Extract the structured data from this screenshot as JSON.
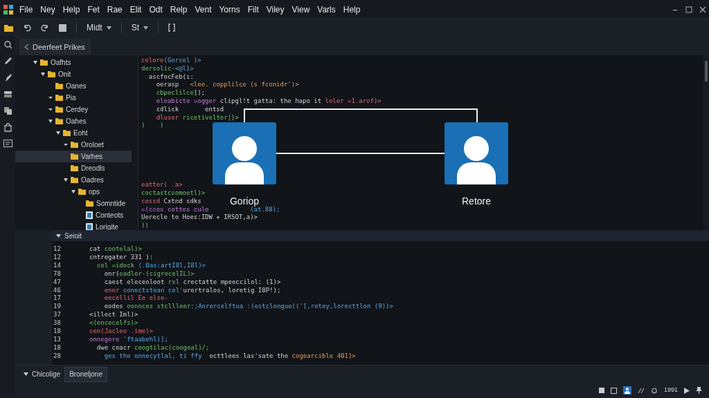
{
  "menu": [
    "File",
    "Ney",
    "Help",
    "Fet",
    "Rae",
    "Elit",
    "Odt",
    "Relp",
    "Vent",
    "Yorns",
    "Filt",
    "Viley",
    "View",
    "Varls",
    "Help"
  ],
  "toolbar": {
    "dropdowns": [
      {
        "label": "Midt"
      },
      {
        "label": "St"
      }
    ]
  },
  "editor_tab": {
    "label": "Deerfeet Prikes"
  },
  "tree": [
    {
      "label": "Oafhts",
      "kind": "folder",
      "expanded": true,
      "selected": false,
      "children": [
        {
          "label": "Onit",
          "kind": "folder",
          "expanded": true,
          "selected": false,
          "children": [
            {
              "label": "Oanes",
              "kind": "folder",
              "selected": false
            },
            {
              "label": "Pia",
              "kind": "folder",
              "expanded": false,
              "selected": false
            },
            {
              "label": "Cerdey",
              "kind": "folder",
              "expanded": false,
              "selected": false
            },
            {
              "label": "Oahes",
              "kind": "folder",
              "expanded": true,
              "selected": false,
              "children": [
                {
                  "label": "Eoht",
                  "kind": "folder",
                  "expanded": true,
                  "selected": false,
                  "children": [
                    {
                      "label": "Oroloet",
                      "kind": "folder",
                      "expanded": false,
                      "selected": false
                    },
                    {
                      "label": "Varhes",
                      "kind": "folder",
                      "selected": true
                    },
                    {
                      "label": "Dreodls",
                      "kind": "folder",
                      "selected": false
                    },
                    {
                      "label": "Oadres",
                      "kind": "folder",
                      "expanded": true,
                      "selected": false,
                      "children": [
                        {
                          "label": "ops",
                          "kind": "folder",
                          "expanded": true,
                          "selected": false,
                          "children": [
                            {
                              "label": "Somntide",
                              "kind": "folder",
                              "selected": false
                            },
                            {
                              "label": "Conteots",
                              "kind": "file",
                              "selected": false
                            },
                            {
                              "label": "Lorigite",
                              "kind": "file",
                              "selected": false
                            }
                          ]
                        }
                      ]
                    }
                  ]
                }
              ]
            }
          ]
        }
      ]
    }
  ],
  "top_code": [
    [
      [
        {
          "text": "celore(",
          "kind": "tag"
        },
        {
          "text": "Gorcel )>",
          "kind": "attr"
        }
      ],
      [
        {
          "text": "dersolic-<",
          "kind": "name"
        },
        {
          "text": "@l}>",
          "kind": "attr"
        }
      ],
      [
        {
          "text": "  ascfocFeb(ı:",
          "kind": "plain"
        }
      ],
      [
        {
          "text": "    oerasp   ",
          "kind": "plain"
        },
        {
          "text": "<lee. copplilce (s fconidr')>",
          "kind": "string"
        }
      ],
      [
        {
          "text": "    cbpeclilce",
          "kind": "name"
        },
        {
          "text": "]);",
          "kind": "plain"
        }
      ],
      [
        {
          "text": "    eleabicte =ogger ",
          "kind": "keyword"
        },
        {
          "text": "clipgl!t gatta: the hapo it ",
          "kind": "plain"
        },
        {
          "text": "loler =1.arof)>",
          "kind": "tag"
        }
      ],
      [
        {
          "text": "    cdlick       entsd",
          "kind": "plain"
        }
      ],
      [
        {
          "text": "    dluser ",
          "kind": "tag"
        },
        {
          "text": "ricetivelter|}>",
          "kind": "name"
        }
      ],
      [
        {
          "text": ")    )",
          "kind": "name"
        }
      ]
    ],
    [
      [
        {
          "text": "eatter( .a>",
          "kind": "tag"
        }
      ],
      [
        {
          "text": "coctastcsomoetl)>",
          "kind": "name"
        }
      ],
      [
        {
          "text": "cossd ",
          "kind": "tag"
        },
        {
          "text": "Cxtnd sdks",
          "kind": "plain"
        }
      ],
      [
        {
          "text": "=(cces cettes cule           ",
          "kind": "keyword"
        },
        {
          "text": "(at.88);",
          "kind": "attr"
        }
      ],
      [
        {
          "text": "Uerecle to Hoes:IDW + IRSOT,a)>",
          "kind": "plain"
        }
      ],
      [
        {
          "text": "))",
          "kind": "name"
        }
      ]
    ]
  ],
  "diagram": {
    "nodes": [
      {
        "label": "Goriop"
      },
      {
        "label": "Retore"
      }
    ]
  },
  "panel": {
    "title": "Seioit"
  },
  "bottom_code": [
    {
      "number": "12",
      "segments": [
        {
          "text": "cat ",
          "kind": "plain"
        },
        {
          "text": "cootelal)>",
          "kind": "name"
        }
      ]
    },
    {
      "number": "12",
      "segments": [
        {
          "text": "cntregater 331 ):",
          "kind": "plain"
        }
      ]
    },
    {
      "number": "14",
      "segments": [
        {
          "text": "  cel =ideck ",
          "kind": "name"
        },
        {
          "text": "(.0as:artI8l,I8l)>",
          "kind": "attr"
        }
      ]
    },
    {
      "number": "78",
      "segments": [
        {
          "text": "    onr(",
          "kind": "plain"
        },
        {
          "text": "eadler-(cigrecelIL)>",
          "kind": "name"
        }
      ]
    },
    {
      "number": "47",
      "segments": [
        {
          "text": "    caest eleceoleot ",
          "kind": "plain"
        },
        {
          "text": "rxl ",
          "kind": "name"
        },
        {
          "text": "crectatte mpeeccilol: (1)>",
          "kind": "plain"
        }
      ]
    },
    {
      "number": "46",
      "segments": [
        {
          "text": "    ener ",
          "kind": "tag"
        },
        {
          "text": "conectstean cel'",
          "kind": "attr"
        },
        {
          "text": "urertralos, loretig I8P!);",
          "kind": "plain"
        }
      ]
    },
    {
      "number": "17",
      "segments": [
        {
          "text": "    eecellil Ee else-",
          "kind": "tag"
        }
      ]
    },
    {
      "number": "19",
      "segments": [
        {
          "text": "    eodes ",
          "kind": "plain"
        },
        {
          "text": "oonoces stcllleer:",
          "kind": "name"
        },
        {
          "text": ";Anrercelftua :(estclongue(('[,retey,lorecttlon (9))>",
          "kind": "attr"
        }
      ]
    },
    {
      "number": "37",
      "segments": [
        {
          "text": "<illect Iml)>",
          "kind": "plain"
        }
      ]
    },
    {
      "number": "38",
      "segments": [
        {
          "text": "<(encecelfs)>",
          "kind": "name"
        }
      ]
    },
    {
      "number": "18",
      "segments": [
        {
          "text": "cen(Jacleo .ime)>",
          "kind": "tag"
        }
      ]
    },
    {
      "number": "13",
      "segments": [
        {
          "text": "onnegore ",
          "kind": "keyword"
        },
        {
          "text": "'ftaabehl)];",
          "kind": "attr"
        }
      ]
    },
    {
      "number": "18",
      "segments": [
        {
          "text": "  dwe coacr ",
          "kind": "plain"
        },
        {
          "text": "ceogtilac(coogeal)/;",
          "kind": "name"
        }
      ]
    },
    {
      "number": "28",
      "segments": [
        {
          "text": "    ges the onnecytlal, ti ffy  ",
          "kind": "attr"
        },
        {
          "text": "ecttlees las'sate the ",
          "kind": "plain"
        },
        {
          "text": "cogearcible 401]>",
          "kind": "string"
        }
      ]
    }
  ],
  "bottom_tabs": [
    {
      "label": "Chicolige",
      "selected": false
    },
    {
      "label": "Broneljone",
      "selected": true
    }
  ],
  "status_bar": {
    "text": "1991"
  }
}
